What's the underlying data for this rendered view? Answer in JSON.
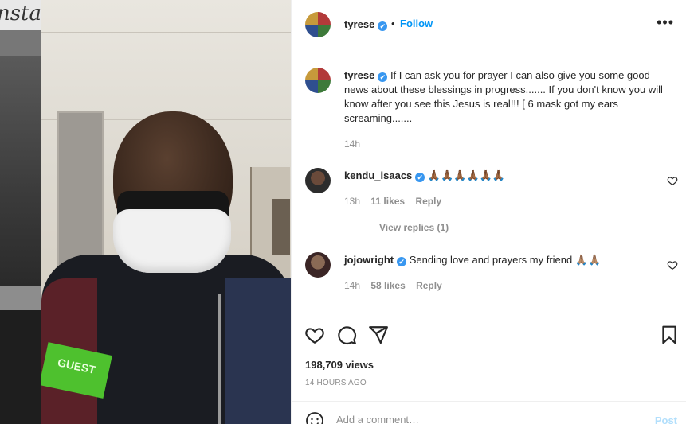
{
  "background_page": {
    "logo": "nstag"
  },
  "media": {
    "sticker_text": "GUEST"
  },
  "post": {
    "author": "tyrese",
    "verified_mark": "✔",
    "separator": "•",
    "follow_label": "Follow",
    "more_label": "•••",
    "caption_user": "tyrese",
    "caption_text": "If I can ask you for prayer I can also give you some good news about these blessings in progress....... If you don't know you will know after you see this Jesus is real!!! [ 6 mask got my ears screaming.......",
    "caption_time": "14h"
  },
  "comments": [
    {
      "user": "kendu_isaacs",
      "text": "🙏🏾🙏🏾🙏🏾🙏🏾🙏🏾🙏🏾",
      "time": "13h",
      "likes": "11 likes",
      "reply": "Reply"
    },
    {
      "user": "jojowright",
      "text": "Sending love and prayers my friend 🙏🏽🙏🏽",
      "time": "14h",
      "likes": "58 likes",
      "reply": "Reply"
    }
  ],
  "view_replies": "View replies (1)",
  "stats": {
    "views": "198,709 views",
    "date": "14 HOURS AGO"
  },
  "add_comment": {
    "placeholder": "Add a comment…",
    "post_label": "Post"
  },
  "colors": {
    "accent": "#0095f6",
    "verified": "#3897f0",
    "post_disabled": "#b2dffc"
  }
}
